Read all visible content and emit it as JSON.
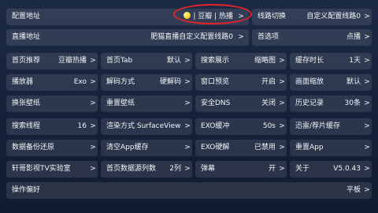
{
  "rows": [
    {
      "cells": [
        {
          "label": "配置地址",
          "value": "| 豆瓣 | 热播",
          "arrow": ">"
        },
        {
          "label": "线路切换",
          "value": "自定义配置线路0",
          "arrow": ">"
        }
      ]
    },
    {
      "cells": [
        {
          "label": "直播地址",
          "value": "肥猫直播自定义配置线路0",
          "arrow": ">"
        },
        {
          "label": "首选项",
          "value": "点播",
          "arrow": ">"
        }
      ]
    },
    {
      "cells": [
        {
          "label": "首页推荐",
          "value": "豆瓣热播",
          "arrow": ">"
        },
        {
          "label": "首页Tab",
          "value": "默认",
          "arrow": ">"
        },
        {
          "label": "搜索展示",
          "value": "缩略图",
          "arrow": ">"
        },
        {
          "label": "缓存时长",
          "value": "1天",
          "arrow": ">"
        }
      ]
    },
    {
      "cells": [
        {
          "label": "播放器",
          "value": "Exo",
          "arrow": ">"
        },
        {
          "label": "解码方式",
          "value": "硬解码",
          "arrow": ">"
        },
        {
          "label": "窗口预览",
          "value": "开启",
          "arrow": ">"
        },
        {
          "label": "画面缩放",
          "value": "默认",
          "arrow": ">"
        }
      ]
    },
    {
      "cells": [
        {
          "label": "换张壁纸",
          "value": "",
          "arrow": ">"
        },
        {
          "label": "重置壁纸",
          "value": "",
          "arrow": ">"
        },
        {
          "label": "安全DNS",
          "value": "关闭",
          "arrow": ">"
        },
        {
          "label": "历史记录",
          "value": "30条",
          "arrow": ">"
        }
      ]
    },
    {
      "cells": [
        {
          "label": "搜索线程",
          "value": "16",
          "arrow": ">"
        },
        {
          "label": "渲染方式 SurfaceView",
          "value": "",
          "arrow": ">"
        },
        {
          "label": "EXO缓冲",
          "value": "50s",
          "arrow": ">"
        },
        {
          "label": "迅雷/荐片缓存",
          "value": "",
          "arrow": ">"
        }
      ]
    },
    {
      "cells": [
        {
          "label": "数据备份还原",
          "value": "",
          "arrow": ">"
        },
        {
          "label": "清空App缓存",
          "value": "",
          "arrow": ">"
        },
        {
          "label": "EXO硬解",
          "value": "已禁用",
          "arrow": ">"
        },
        {
          "label": "重置App",
          "value": "",
          "arrow": ">"
        }
      ]
    },
    {
      "cells": [
        {
          "label": "轩哥影视TV实验室",
          "value": "",
          "arrow": ">"
        },
        {
          "label": "首页数据源列数",
          "value": "2列",
          "arrow": ">"
        },
        {
          "label": "弹幕",
          "value": "开",
          "arrow": ">"
        },
        {
          "label": "关于",
          "value": "V5.0.43",
          "arrow": ">"
        }
      ]
    },
    {
      "cells": [
        {
          "label": "操作偏好",
          "value": "平板",
          "arrow": ">"
        }
      ]
    }
  ],
  "colors": {
    "highlight": "#e8212a",
    "text": "#f2f4f8",
    "cell_bg": "rgba(255,255,255,0.10)"
  }
}
